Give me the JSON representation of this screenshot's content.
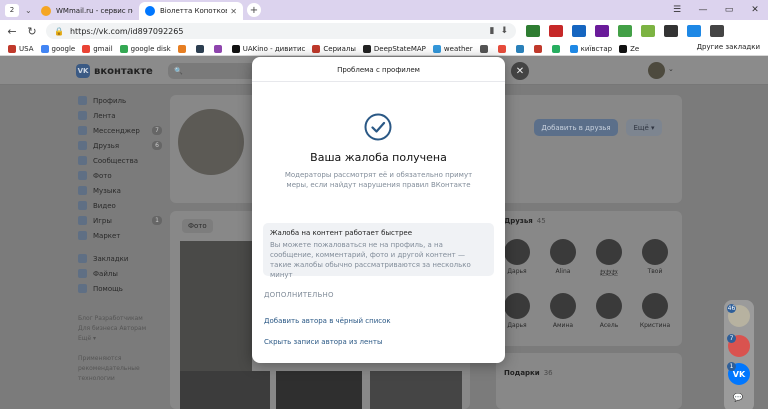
{
  "browser": {
    "tab_count": "2",
    "tabs": [
      {
        "title": "WMmail.ru - сервис почт",
        "favicon_color": "#f5a623"
      },
      {
        "title": "Віолетта Копоткова",
        "favicon_color": "#0077ff"
      }
    ],
    "address": "https://vk.com/id897092265",
    "bookmarks": [
      {
        "label": "USA",
        "color": "#c0392b"
      },
      {
        "label": "google",
        "color": "#4285f4"
      },
      {
        "label": "gmail",
        "color": "#ea4335"
      },
      {
        "label": "google disk",
        "color": "#34a853"
      },
      {
        "label": "",
        "color": "#e67e22"
      },
      {
        "label": "",
        "color": "#2c3e50"
      },
      {
        "label": "",
        "color": "#8e44ad"
      },
      {
        "label": "UAKino - дивитис",
        "color": "#111111"
      },
      {
        "label": "Сериалы",
        "color": "#c0392b"
      },
      {
        "label": "DeepStateMAP",
        "color": "#222222"
      },
      {
        "label": "weather",
        "color": "#3498db"
      },
      {
        "label": "",
        "color": "#555555"
      },
      {
        "label": "",
        "color": "#e74c3c"
      },
      {
        "label": "",
        "color": "#2980b9"
      },
      {
        "label": "",
        "color": "#c0392b"
      },
      {
        "label": "",
        "color": "#27ae60"
      },
      {
        "label": "київстар",
        "color": "#1e88e5"
      },
      {
        "label": "Ze",
        "color": "#111111"
      }
    ],
    "other_bookmarks": "Другие закладки"
  },
  "vk": {
    "logo_text": "вконтакте",
    "sidebar": [
      {
        "label": "Профиль",
        "count": ""
      },
      {
        "label": "Лента",
        "count": ""
      },
      {
        "label": "Мессенджер",
        "count": "7"
      },
      {
        "label": "Друзья",
        "count": "6"
      },
      {
        "label": "Сообщества",
        "count": ""
      },
      {
        "label": "Фото",
        "count": ""
      },
      {
        "label": "Музыка",
        "count": ""
      },
      {
        "label": "Видео",
        "count": ""
      },
      {
        "label": "Игры",
        "count": "1"
      },
      {
        "label": "Маркет",
        "count": ""
      },
      {
        "label": "Закладки",
        "count": ""
      },
      {
        "label": "Файлы",
        "count": ""
      },
      {
        "label": "Помощь",
        "count": ""
      }
    ],
    "sidebar_footer": [
      "Блог  Разработчикам",
      "Для бизнеса  Авторам",
      "Ещё ▾"
    ],
    "sidebar_footer2": "Применяются рекомендательные технологии",
    "add_friend": "Добавить в друзья",
    "more": "Ещё ▾",
    "photo_tab": "Фото",
    "friends_title": "Друзья",
    "friends_count": "45",
    "friends": [
      "Дарья",
      "Alina",
      "赵赵赵",
      "Твой",
      "Дарья",
      "Амина",
      "Асель",
      "Кристина"
    ],
    "gifts_title": "Подарки",
    "gifts_count": "36",
    "chat_badges": [
      "46",
      "7",
      "1"
    ]
  },
  "modal": {
    "title": "Проблема с профилем",
    "heading": "Ваша жалоба получена",
    "description": "Модераторы рассмотрят её и обязательно примут меры, если найдут нарушения правил ВКонтакте",
    "info_title": "Жалоба на контент работает быстрее",
    "info_text": "Вы можете пожаловаться не на профиль, а на сообщение, комментарий, фото и другой контент — такие жалобы обычно рассматриваются за несколько минут",
    "section_label": "ДОПОЛНИТЕЛЬНО",
    "link_blacklist": "Добавить автора в чёрный список",
    "link_hide": "Скрыть записи автора из ленты",
    "accent_color": "#2a5885"
  }
}
